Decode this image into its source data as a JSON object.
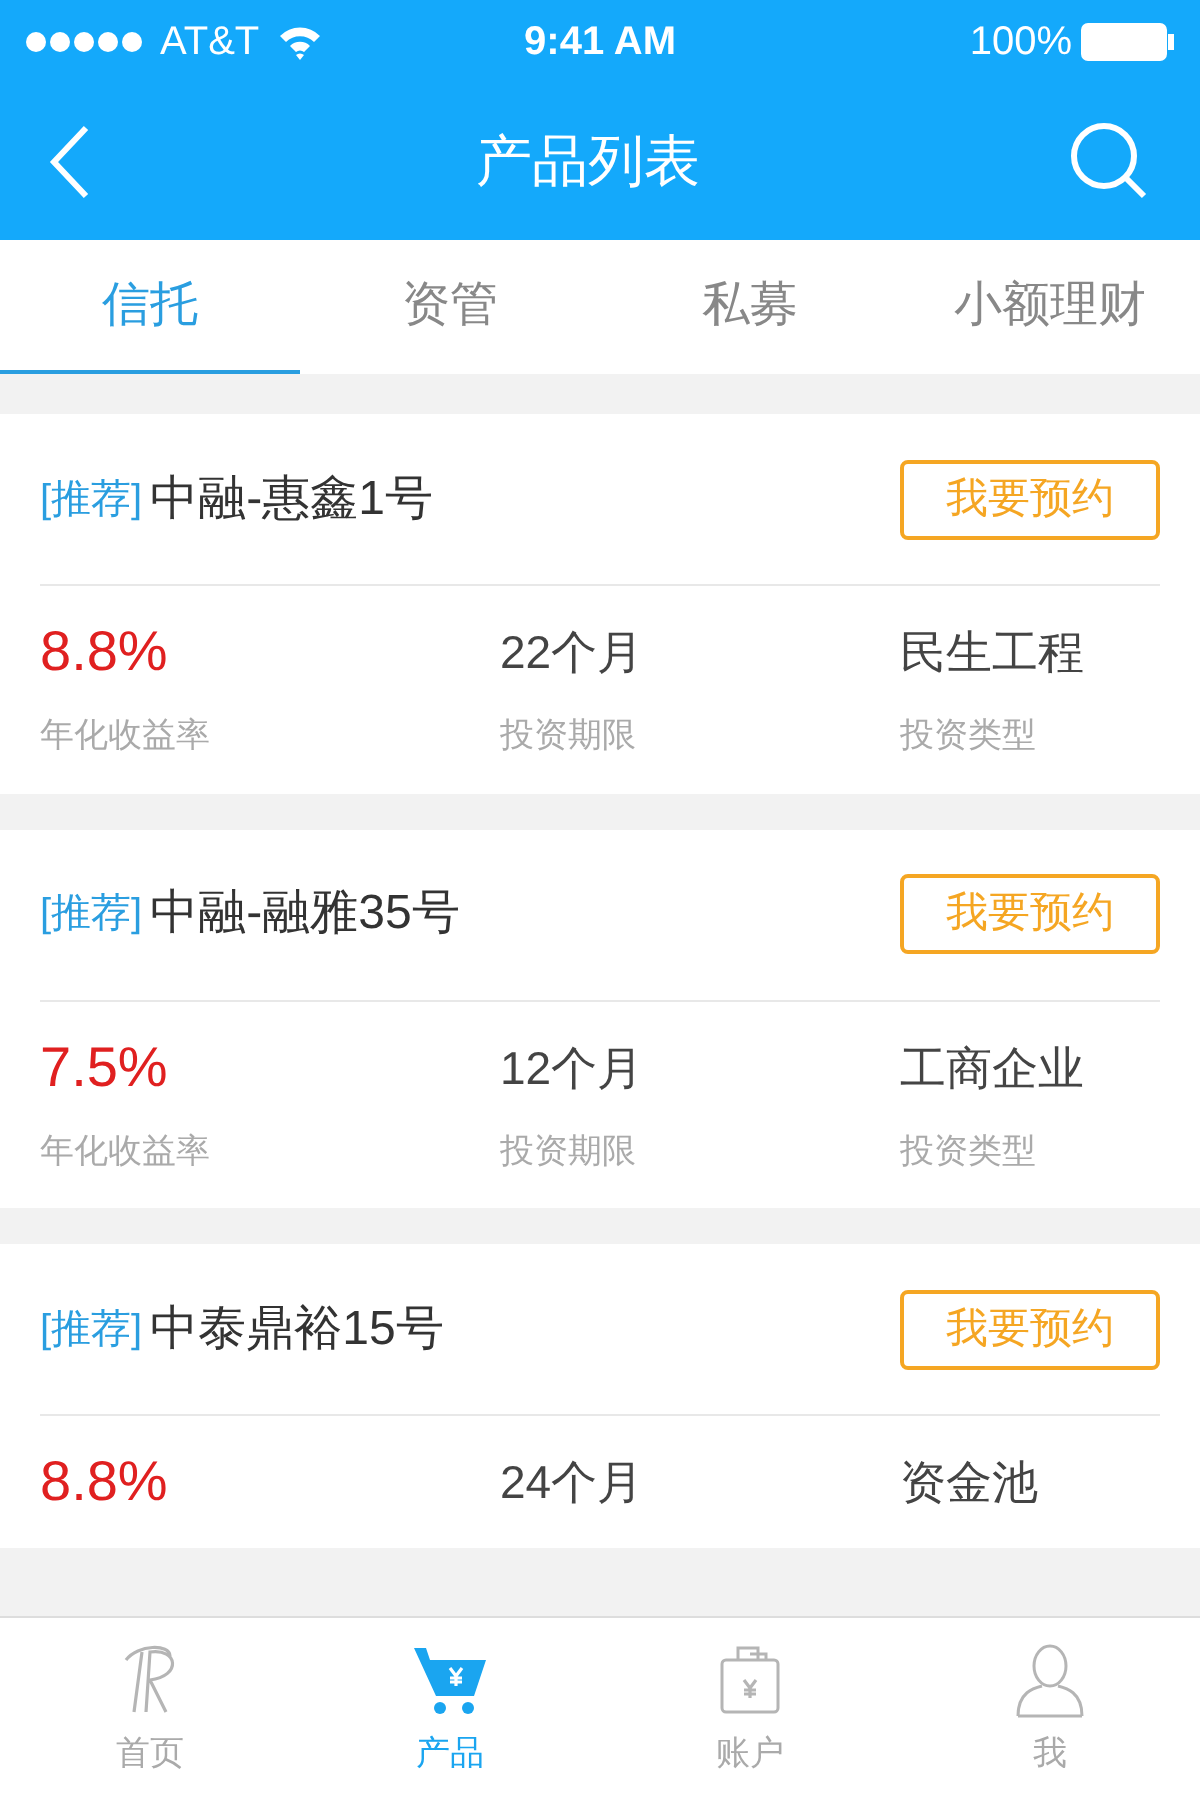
{
  "status_bar": {
    "carrier": "AT&T",
    "time": "9:41 AM",
    "battery": "100%"
  },
  "nav": {
    "title": "产品列表"
  },
  "tabs": [
    {
      "label": "信托",
      "selected": true
    },
    {
      "label": "资管",
      "selected": false
    },
    {
      "label": "私募",
      "selected": false
    },
    {
      "label": "小额理财",
      "selected": false
    }
  ],
  "products": [
    {
      "tag": "[推荐]",
      "name": "中融-惠鑫1号",
      "button": "我要预约",
      "rate": "8.8%",
      "rate_label": "年化收益率",
      "term": "22个月",
      "term_label": "投资期限",
      "type": "民生工程",
      "type_label": "投资类型"
    },
    {
      "tag": "[推荐]",
      "name": "中融-融雅35号",
      "button": "我要预约",
      "rate": "7.5%",
      "rate_label": "年化收益率",
      "term": "12个月",
      "term_label": "投资期限",
      "type": "工商企业",
      "type_label": "投资类型"
    },
    {
      "tag": "[推荐]",
      "name": "中泰鼎裕15号",
      "button": "我要预约",
      "rate": "8.8%",
      "term": "24个月",
      "type": "资金池"
    }
  ],
  "bottom_nav": [
    {
      "kind": "home",
      "label": "首页",
      "selected": false
    },
    {
      "kind": "cart",
      "label": "产品",
      "selected": true
    },
    {
      "kind": "bag",
      "label": "账户",
      "selected": false
    },
    {
      "kind": "person",
      "label": "我",
      "selected": false
    }
  ]
}
